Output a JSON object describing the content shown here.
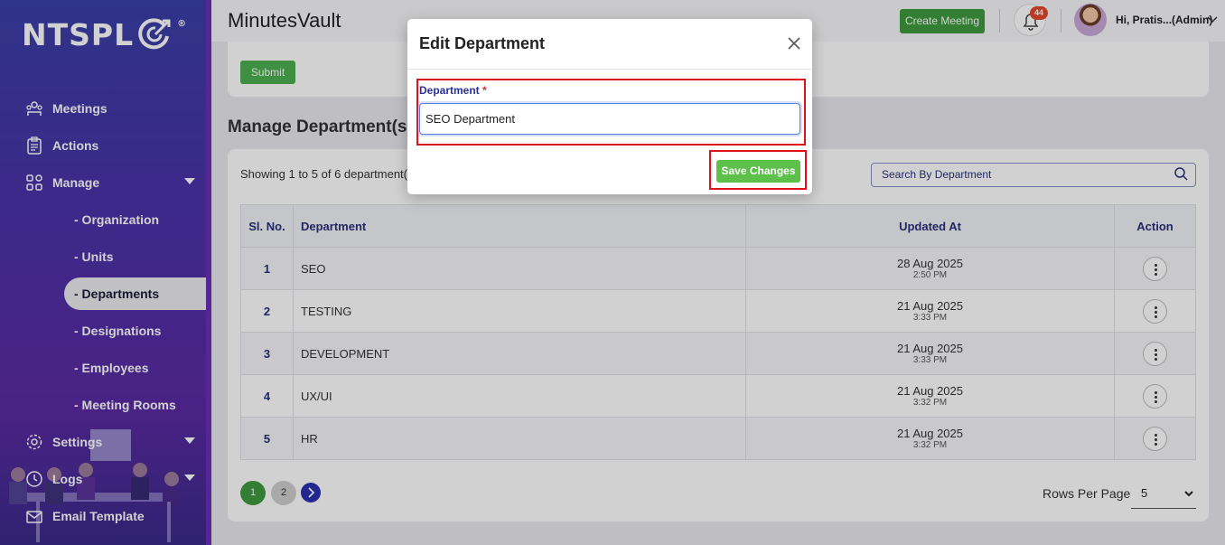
{
  "brand": {
    "logo_text": "NTSPL",
    "reg": "®"
  },
  "sidebar": {
    "items": [
      {
        "label": "Meetings",
        "icon": "meetings-icon"
      },
      {
        "label": "Actions",
        "icon": "clipboard-icon"
      },
      {
        "label": "Manage",
        "icon": "grid-icon"
      },
      {
        "label": "Settings",
        "icon": "gear-icon"
      },
      {
        "label": "Logs",
        "icon": "history-icon"
      },
      {
        "label": "Email Template",
        "icon": "mail-icon"
      }
    ],
    "manage_sub": [
      {
        "label": "- Organization"
      },
      {
        "label": "- Units"
      },
      {
        "label": "- Departments",
        "active": true
      },
      {
        "label": "- Designations"
      },
      {
        "label": "- Employees"
      },
      {
        "label": "- Meeting Rooms"
      }
    ]
  },
  "header": {
    "app_title": "MinutesVault",
    "create_meeting_label": "Create Meeting",
    "notification_count": "44",
    "user_greeting": "Hi, Pratis...(Admin)"
  },
  "form": {
    "submit_label": "Submit"
  },
  "manage": {
    "title": "Manage Department(s)",
    "showing": "Showing 1 to 5 of 6 department(s)",
    "search_placeholder": "Search By Department",
    "columns": {
      "sl": "Sl. No.",
      "department": "Department",
      "updated": "Updated At",
      "action": "Action"
    },
    "rows": [
      {
        "sl": "1",
        "department": "SEO",
        "date": "28 Aug 2025",
        "time": "2:50 PM"
      },
      {
        "sl": "2",
        "department": "TESTING",
        "date": "21 Aug 2025",
        "time": "3:33 PM"
      },
      {
        "sl": "3",
        "department": "DEVELOPMENT",
        "date": "21 Aug 2025",
        "time": "3:33 PM"
      },
      {
        "sl": "4",
        "department": "UX/UI",
        "date": "21 Aug 2025",
        "time": "3:32 PM"
      },
      {
        "sl": "5",
        "department": "HR",
        "date": "21 Aug 2025",
        "time": "3:32 PM"
      }
    ],
    "pagination": {
      "page1": "1",
      "page2": "2"
    },
    "rows_per_page_label": "Rows Per Page",
    "rows_per_page_value": "5"
  },
  "modal": {
    "title": "Edit Department",
    "field_label": "Department",
    "required_mark": "*",
    "field_value": "SEO Department",
    "save_label": "Save Changes"
  }
}
